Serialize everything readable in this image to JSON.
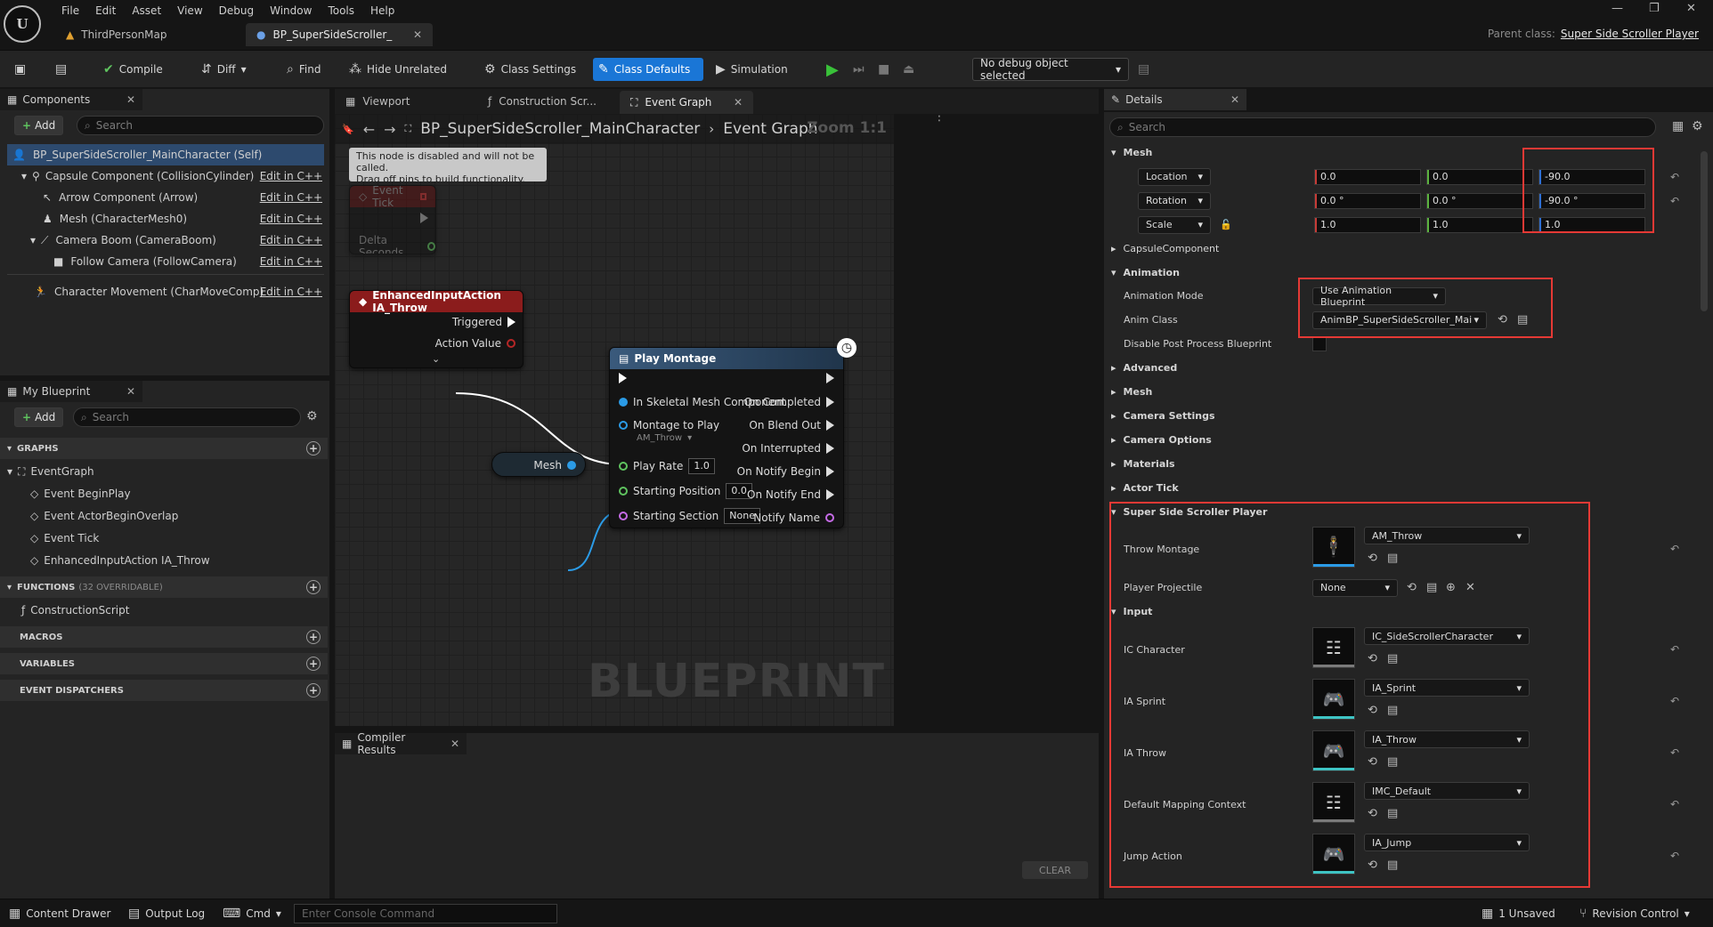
{
  "app": {
    "menu": [
      "File",
      "Edit",
      "Asset",
      "View",
      "Debug",
      "Window",
      "Tools",
      "Help"
    ],
    "logo": "U",
    "tabs": [
      {
        "label": "ThirdPersonMap"
      },
      {
        "label": "BP_SuperSideScroller_"
      }
    ],
    "parent_class_label": "Parent class:",
    "parent_class_value": "Super Side Scroller Player"
  },
  "toolbar": {
    "compile": "Compile",
    "diff": "Diff",
    "find": "Find",
    "hide_unrelated": "Hide Unrelated",
    "class_settings": "Class Settings",
    "class_defaults": "Class Defaults",
    "simulation": "Simulation",
    "debug_object": "No debug object selected"
  },
  "components": {
    "title": "Components",
    "add": "Add",
    "search_placeholder": "Search",
    "self": "BP_SuperSideScroller_MainCharacter (Self)",
    "items": [
      {
        "label": "Capsule Component (CollisionCylinder)",
        "edit": "Edit in C++"
      },
      {
        "label": "Arrow Component (Arrow)",
        "edit": "Edit in C++"
      },
      {
        "label": "Mesh (CharacterMesh0)",
        "edit": "Edit in C++"
      },
      {
        "label": "Camera Boom (CameraBoom)",
        "edit": "Edit in C++"
      },
      {
        "label": "Follow Camera (FollowCamera)",
        "edit": "Edit in C++"
      },
      {
        "label": "Character Movement (CharMoveComp)",
        "edit": "Edit in C++"
      }
    ]
  },
  "my_blueprint": {
    "title": "My Blueprint",
    "add": "Add",
    "search_placeholder": "Search",
    "graphs_label": "GRAPHS",
    "event_graph": "EventGraph",
    "events": [
      "Event BeginPlay",
      "Event ActorBeginOverlap",
      "Event Tick",
      "EnhancedInputAction IA_Throw"
    ],
    "functions_label": "FUNCTIONS",
    "functions_override": "(32 OVERRIDABLE)",
    "construction_script": "ConstructionScript",
    "macros_label": "MACROS",
    "variables_label": "VARIABLES",
    "dispatchers_label": "EVENT DISPATCHERS"
  },
  "graph_tabs": {
    "viewport": "Viewport",
    "construction": "Construction Scr...",
    "event_graph": "Event Graph"
  },
  "graph": {
    "breadcrumb_bp": "BP_SuperSideScroller_MainCharacter",
    "breadcrumb_graph": "Event Graph",
    "zoom": "Zoom 1:1",
    "watermark": "BLUEPRINT",
    "disabled_note_line1": "This node is disabled and will not be called.",
    "disabled_note_line2": "Drag off pins to build functionality.",
    "event_tick": "Event Tick",
    "delta_seconds": "Delta Seconds",
    "input_node_title": "EnhancedInputAction IA_Throw",
    "triggered": "Triggered",
    "action_value": "Action Value",
    "mesh_node": "Mesh",
    "play_montage": {
      "title": "Play Montage",
      "in_mesh": "In Skeletal Mesh Component",
      "montage_to_play": "Montage to Play",
      "montage_value": "AM_Throw",
      "play_rate": "Play Rate",
      "play_rate_value": "1.0",
      "starting_position": "Starting Position",
      "starting_position_value": "0.0",
      "starting_section": "Starting Section",
      "starting_section_value": "None",
      "on_completed": "On Completed",
      "on_blend_out": "On Blend Out",
      "on_interrupted": "On Interrupted",
      "on_notify_begin": "On Notify Begin",
      "on_notify_end": "On Notify End",
      "notify_name": "Notify Name"
    }
  },
  "compiler": {
    "title": "Compiler Results",
    "clear": "CLEAR"
  },
  "details": {
    "title": "Details",
    "search_placeholder": "Search",
    "mesh_cat": "Mesh",
    "location": "Location",
    "rotation": "Rotation",
    "scale": "Scale",
    "loc": [
      "0.0",
      "0.0",
      "-90.0"
    ],
    "rot": [
      "0.0 °",
      "0.0 °",
      "-90.0 °"
    ],
    "scl": [
      "1.0",
      "1.0",
      "1.0"
    ],
    "capsule_cat": "CapsuleComponent",
    "animation_cat": "Animation",
    "animation_mode_label": "Animation Mode",
    "animation_mode_value": "Use Animation Blueprint",
    "anim_class_label": "Anim Class",
    "anim_class_value": "AnimBP_SuperSideScroller_Mai",
    "disable_ppb_label": "Disable Post Process Blueprint",
    "collapsed_cats": [
      "Advanced",
      "Mesh",
      "Camera Settings",
      "Camera Options",
      "Materials",
      "Actor Tick"
    ],
    "ssp_cat": "Super Side Scroller Player",
    "throw_montage_label": "Throw Montage",
    "throw_montage_value": "AM_Throw",
    "player_projectile_label": "Player Projectile",
    "player_projectile_value": "None",
    "input_cat": "Input",
    "inputs": [
      {
        "label": "IC Character",
        "value": "IC_SideScrollerCharacter",
        "icon": "mapping-context-icon"
      },
      {
        "label": "IA Sprint",
        "value": "IA_Sprint",
        "icon": "input-action-icon"
      },
      {
        "label": "IA Throw",
        "value": "IA_Throw",
        "icon": "input-action-icon"
      },
      {
        "label": "Default Mapping Context",
        "value": "IMC_Default",
        "icon": "mapping-context-icon"
      },
      {
        "label": "Jump Action",
        "value": "IA_Jump",
        "icon": "input-action-icon"
      }
    ]
  },
  "bottom": {
    "content_drawer": "Content Drawer",
    "output_log": "Output Log",
    "cmd": "Cmd",
    "console_placeholder": "Enter Console Command",
    "unsaved": "1 Unsaved",
    "revision": "Revision Control"
  },
  "colors": {
    "accent": "#1a76d6",
    "highlight_box": "#e53935",
    "event_node_header": "#8b1c1c",
    "function_node_header": "#2f4d6e"
  }
}
